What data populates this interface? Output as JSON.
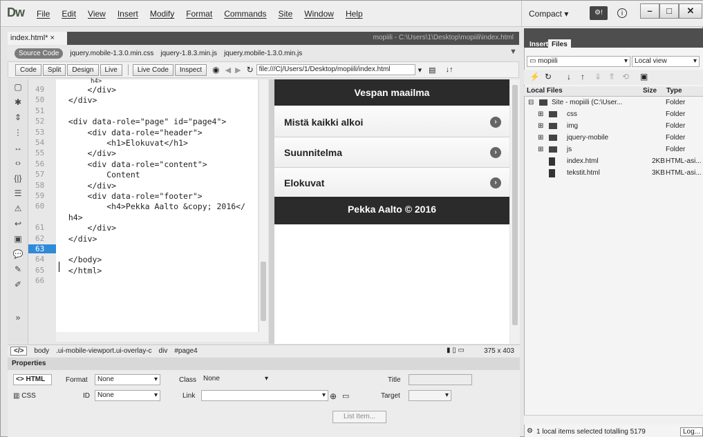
{
  "app": {
    "logo": "Dw"
  },
  "menu": [
    "File",
    "Edit",
    "View",
    "Insert",
    "Modify",
    "Format",
    "Commands",
    "Site",
    "Window",
    "Help"
  ],
  "workspace": {
    "label": "Compact",
    "extension_icon": "CSS-extension-icon"
  },
  "doc": {
    "tab": "index.html*",
    "path_title": "mopiili - C:\\Users\\1\\Desktop\\mopiili\\index.html"
  },
  "related": {
    "source": "Source Code",
    "files": [
      "jquery.mobile-1.3.0.min.css",
      "jquery-1.8.3.min.js",
      "jquery.mobile-1.3.0.min.js"
    ]
  },
  "toolbar": {
    "code": "Code",
    "split": "Split",
    "design": "Design",
    "live": "Live",
    "live_code": "Live Code",
    "inspect": "Inspect",
    "address": "file:///C|/Users/1/Desktop/mopiili/index.html"
  },
  "code": {
    "partial": "h4>",
    "lines": [
      {
        "n": "49",
        "t": "      </div>"
      },
      {
        "n": "50",
        "t": "  </div>"
      },
      {
        "n": "51",
        "t": ""
      },
      {
        "n": "52",
        "t": "  <div data-role=\"page\" id=\"page4\">"
      },
      {
        "n": "53",
        "t": "      <div data-role=\"header\">"
      },
      {
        "n": "54",
        "t": "          <h1>Elokuvat</h1>"
      },
      {
        "n": "55",
        "t": "      </div>"
      },
      {
        "n": "56",
        "t": "      <div data-role=\"content\">"
      },
      {
        "n": "57",
        "t": "          Content"
      },
      {
        "n": "58",
        "t": "      </div>"
      },
      {
        "n": "59",
        "t": "      <div data-role=\"footer\">"
      },
      {
        "n": "60",
        "t": "          <h4>Pekka Aalto &copy; 2016</"
      },
      {
        "n": "",
        "t": "  h4>"
      },
      {
        "n": "61",
        "t": "      </div>"
      },
      {
        "n": "62",
        "t": "  </div>"
      },
      {
        "n": "63",
        "t": ""
      },
      {
        "n": "64",
        "t": "  </body>"
      },
      {
        "n": "65",
        "t": "  </html>"
      },
      {
        "n": "66",
        "t": ""
      }
    ]
  },
  "mobile": {
    "header": "Vespan maailma",
    "items": [
      "Mistä kaikki alkoi",
      "Suunnitelma",
      "Elokuvat"
    ],
    "footer": "Pekka Aalto © 2016"
  },
  "tagbar": {
    "code": "</>",
    "tags": [
      "body",
      ".ui-mobile-viewport.ui-overlay-c",
      "div",
      "#page4"
    ],
    "size": "375 x 403"
  },
  "properties": {
    "title": "Properties",
    "html": "HTML",
    "css": "CSS",
    "format_label": "Format",
    "format": "None",
    "class_label": "Class",
    "class": "None",
    "id_label": "ID",
    "id": "None",
    "link_label": "Link",
    "title_label": "Title",
    "target_label": "Target",
    "list_item": "List Item..."
  },
  "files": {
    "tabs": [
      "Insert",
      "Files"
    ],
    "site": "mopiili",
    "view": "Local view",
    "columns": [
      "Local Files",
      "Size",
      "Type"
    ],
    "rows": [
      {
        "name": "Site - mopiili (C:\\User...",
        "size": "",
        "type": "Folder"
      },
      {
        "name": "css",
        "size": "",
        "type": "Folder"
      },
      {
        "name": "img",
        "size": "",
        "type": "Folder"
      },
      {
        "name": "jquery-mobile",
        "size": "",
        "type": "Folder"
      },
      {
        "name": "js",
        "size": "",
        "type": "Folder"
      },
      {
        "name": "index.html",
        "size": "2KB",
        "type": "HTML-asi..."
      },
      {
        "name": "tekstit.html",
        "size": "3KB",
        "type": "HTML-asi..."
      }
    ],
    "status": "1 local items selected totalling 5179",
    "log": "Log..."
  }
}
